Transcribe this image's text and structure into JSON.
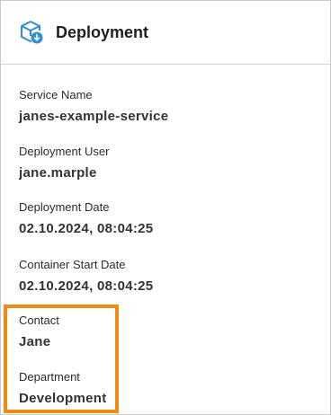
{
  "header": {
    "title": "Deployment",
    "icon": "package-deploy-icon",
    "icon_color": "#2f8fd6"
  },
  "fields": [
    {
      "label": "Service Name",
      "value": "janes-example-service"
    },
    {
      "label": "Deployment User",
      "value": "jane.marple"
    },
    {
      "label": "Deployment Date",
      "value": "02.10.2024, 08:04:25"
    },
    {
      "label": "Container Start Date",
      "value": "02.10.2024, 08:04:25"
    },
    {
      "label": "Contact",
      "value": "Jane"
    },
    {
      "label": "Department",
      "value": "Development"
    }
  ],
  "highlight": {
    "color": "#f08a16"
  }
}
